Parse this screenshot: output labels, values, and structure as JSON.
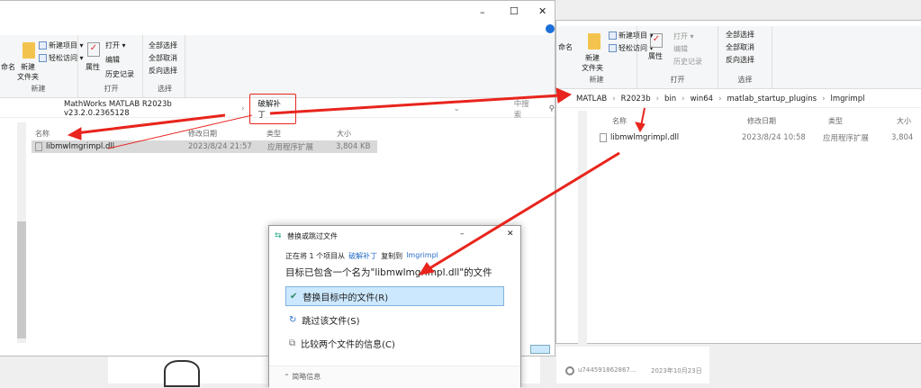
{
  "left_window": {
    "ribbon": {
      "rename": "命名",
      "new_folder": "新建\n文件夹",
      "new_item": "新建项目 ▾",
      "easy_access": "轻松访问 ▾",
      "group_new": "新建",
      "properties": "属性",
      "open": "打开 ▾",
      "edit": "编辑",
      "history": "历史记录",
      "group_open": "打开",
      "select_all": "全部选择",
      "select_none": "全部取消",
      "invert": "反向选择",
      "group_select": "选择"
    },
    "breadcrumb": [
      "MathWorks MATLAB R2023b v23.2.0.2365128",
      "破解补丁"
    ],
    "search_placeholder": "中搜索",
    "columns": [
      "名称",
      "修改日期",
      "类型",
      "大小"
    ],
    "files": [
      {
        "name": "libmwlmgrimpl.dll",
        "date": "2023/8/24 21:57",
        "type": "应用程序扩展",
        "size": "3,804 KB"
      }
    ]
  },
  "right_window": {
    "ribbon": {
      "rename": "命名",
      "new_folder": "新建\n文件夹",
      "new_item": "新建项目 ▾",
      "easy_access": "轻松访问 ▾",
      "group_new": "新建",
      "properties": "属性",
      "open": "打开 ▾",
      "edit": "编辑",
      "history": "历史记录",
      "group_open": "打开",
      "select_all": "全部选择",
      "select_none": "全部取消",
      "invert": "反向选择",
      "group_select": "选择"
    },
    "breadcrumb": [
      "MATLAB",
      "R2023b",
      "bin",
      "win64",
      "matlab_startup_plugins",
      "lmgrimpl"
    ],
    "columns": [
      "名称",
      "修改日期",
      "类型",
      "大小"
    ],
    "files": [
      {
        "name": "libmwlmgrimpl.dll",
        "date": "2023/8/24 10:58",
        "type": "应用程序扩展",
        "size": "3,804"
      }
    ]
  },
  "dialog": {
    "title": "替换或跳过文件",
    "copy_prefix": "正在将 1 个项目从",
    "source": "破解补丁",
    "copy_mid": "复制到",
    "dest": "lmgrimpl",
    "message": "目标已包含一个名为\"libmwlmgrimpl.dll\"的文件",
    "options": [
      "替换目标中的文件(R)",
      "跳过该文件(S)",
      "比较两个文件的信息(C)"
    ],
    "details": "简略信息"
  },
  "background": {
    "comment_user": "u744591862867...",
    "comment_date": "2023年10月23日"
  },
  "colors": {
    "arrow": "#e8241c",
    "selected": "#cce8ff",
    "link": "#2a6fc9"
  }
}
